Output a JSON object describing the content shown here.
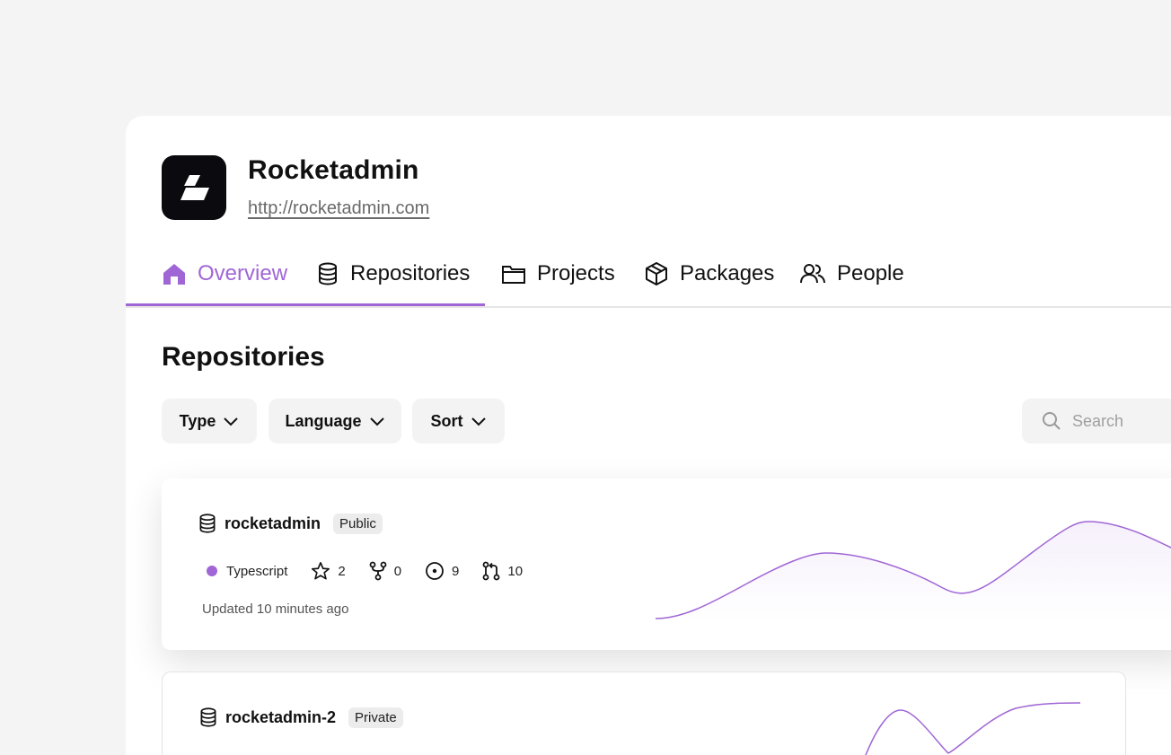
{
  "org": {
    "name": "Rocketadmin",
    "url": "http://rocketadmin.com"
  },
  "tabs": [
    {
      "label": "Overview",
      "icon": "home-icon",
      "active": true
    },
    {
      "label": "Repositories",
      "icon": "database-icon",
      "active": false
    },
    {
      "label": "Projects",
      "icon": "folder-icon",
      "active": false
    },
    {
      "label": "Packages",
      "icon": "package-icon",
      "active": false
    },
    {
      "label": "People",
      "icon": "people-icon",
      "active": false
    }
  ],
  "section_title": "Repositories",
  "filters": {
    "type": "Type",
    "language": "Language",
    "sort": "Sort"
  },
  "search": {
    "placeholder": "Search"
  },
  "repos": [
    {
      "name": "rocketadmin",
      "visibility": "Public",
      "language": "Typescript",
      "stars": "2",
      "forks": "0",
      "issues": "9",
      "pull_requests": "10",
      "updated": "Updated 10 minutes ago"
    },
    {
      "name": "rocketadmin-2",
      "visibility": "Private"
    }
  ],
  "colors": {
    "accent": "#a066d6",
    "background": "#f4f4f4",
    "filter_bg": "#f2f3f2"
  }
}
